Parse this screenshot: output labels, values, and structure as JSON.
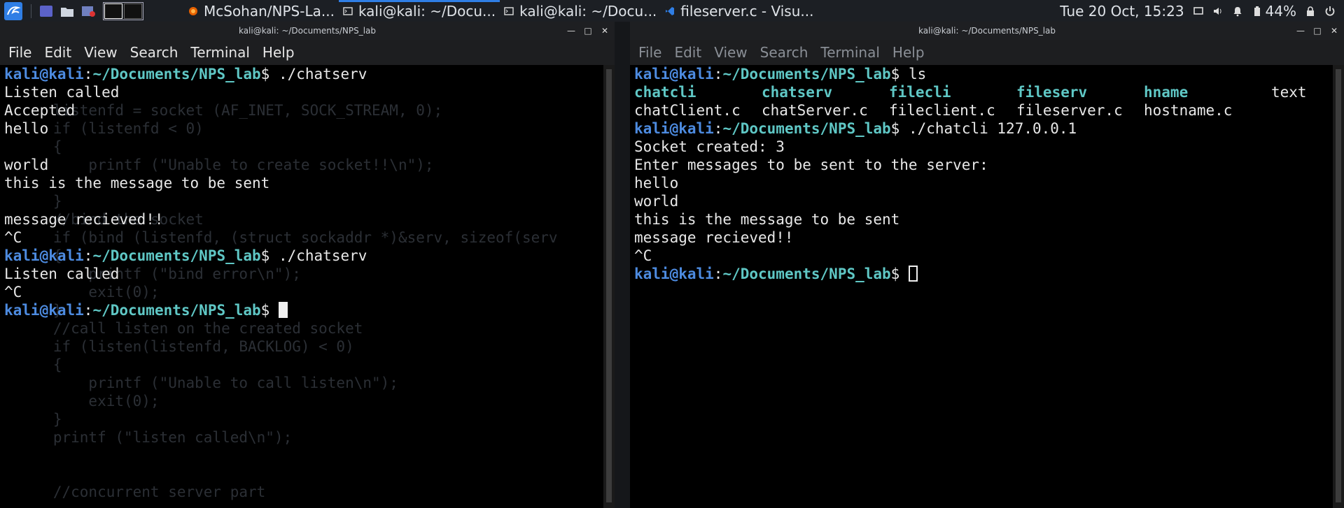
{
  "panel": {
    "tasks": [
      {
        "label": "McSohan/NPS-La...",
        "icon": "firefox-icon",
        "active": false
      },
      {
        "label": "kali@kali: ~/Docu...",
        "icon": "terminal-icon",
        "active": true
      },
      {
        "label": "kali@kali: ~/Docu...",
        "icon": "terminal-icon",
        "active": false
      },
      {
        "label": "fileserver.c - Visu...",
        "icon": "vscode-icon",
        "active": false
      }
    ],
    "clock": "Tue 20 Oct, 15:23",
    "battery": "44%"
  },
  "left": {
    "title": "kali@kali: ~/Documents/NPS_lab",
    "menu": [
      "File",
      "Edit",
      "View",
      "Search",
      "Terminal",
      "Help"
    ],
    "user": "kali@kali",
    "colon": ":",
    "path": "~/Documents/NPS_lab",
    "dollar": "$",
    "lines": [
      {
        "type": "prompt",
        "cmd": " ./chatserv"
      },
      {
        "type": "text",
        "text": "Listen called"
      },
      {
        "type": "text",
        "text": "Accepted"
      },
      {
        "type": "text",
        "text": "hello"
      },
      {
        "type": "text",
        "text": ""
      },
      {
        "type": "text",
        "text": "world"
      },
      {
        "type": "text",
        "text": "this is the message to be sent"
      },
      {
        "type": "text",
        "text": ""
      },
      {
        "type": "text",
        "text": "message recieved!!"
      },
      {
        "type": "text",
        "text": "^C"
      },
      {
        "type": "prompt",
        "cmd": " ./chatserv"
      },
      {
        "type": "text",
        "text": "Listen called"
      },
      {
        "type": "text",
        "text": "^C"
      },
      {
        "type": "prompt",
        "cmd": " ",
        "cursor": "solid"
      }
    ],
    "background_code": [
      "",
      "",
      "      listenfd = socket (AF_INET, SOCK_STREAM, 0);",
      "      if (listenfd < 0)",
      "      {",
      "          printf (\"Unable to create socket!!\\n\");",
      "",
      "      }",
      "      //bind the socket",
      "      if (bind (listenfd, (struct sockaddr *)&serv, sizeof(serv",
      "      {",
      "          printf (\"bind error\\n\");",
      "          exit(0);",
      "      }",
      "      //call listen on the created socket",
      "      if (listen(listenfd, BACKLOG) < 0)",
      "      {",
      "          printf (\"Unable to call listen\\n\");",
      "          exit(0);",
      "      }",
      "      printf (\"listen called\\n\");",
      "",
      "",
      "      //concurrent server part"
    ]
  },
  "right": {
    "title": "kali@kali: ~/Documents/NPS_lab",
    "menu": [
      "File",
      "Edit",
      "View",
      "Search",
      "Terminal",
      "Help"
    ],
    "user": "kali@kali",
    "colon": ":",
    "path": "~/Documents/NPS_lab",
    "dollar": "$",
    "ls_cmd": " ls",
    "ls_dirs": [
      "chatcli",
      "chatserv",
      "filecli",
      "fileserv",
      "hname"
    ],
    "ls_plain": "text",
    "ls_files": [
      "chatClient.c",
      "chatServer.c",
      "fileclient.c",
      "fileserver.c",
      "hostname.c"
    ],
    "lines_after": [
      {
        "type": "prompt",
        "cmd": " ./chatcli 127.0.0.1"
      },
      {
        "type": "text",
        "text": "Socket created: 3"
      },
      {
        "type": "text",
        "text": "Enter messages to be sent to the server:"
      },
      {
        "type": "text",
        "text": "hello"
      },
      {
        "type": "text",
        "text": "world"
      },
      {
        "type": "text",
        "text": "this is the message to be sent"
      },
      {
        "type": "text",
        "text": "message recieved!!"
      },
      {
        "type": "text",
        "text": "^C"
      },
      {
        "type": "prompt",
        "cmd": " ",
        "cursor": "hollow"
      }
    ]
  },
  "colors": {
    "user": "#4d8be0",
    "path": "#5fc7c5",
    "accent": "#2f7ee5"
  }
}
